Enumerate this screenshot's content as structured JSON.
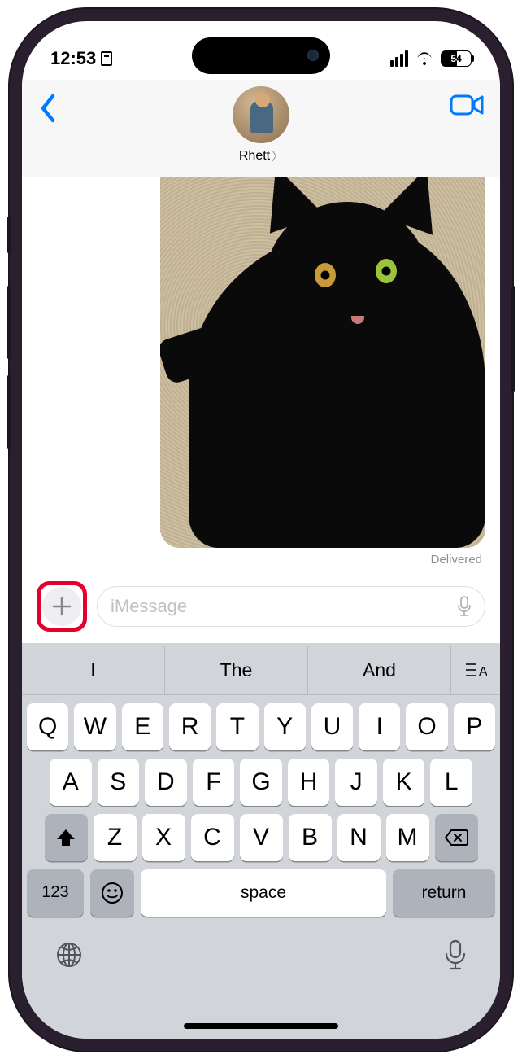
{
  "status": {
    "time": "12:53",
    "battery_pct": "54"
  },
  "header": {
    "contact_name": "Rhett"
  },
  "thread": {
    "last_status": "Delivered"
  },
  "compose": {
    "placeholder": "iMessage"
  },
  "keyboard": {
    "suggestions": [
      "I",
      "The",
      "And"
    ],
    "row1": [
      "Q",
      "W",
      "E",
      "R",
      "T",
      "Y",
      "U",
      "I",
      "O",
      "P"
    ],
    "row2": [
      "A",
      "S",
      "D",
      "F",
      "G",
      "H",
      "J",
      "K",
      "L"
    ],
    "row3": [
      "Z",
      "X",
      "C",
      "V",
      "B",
      "N",
      "M"
    ],
    "fn_label": "123",
    "space_label": "space",
    "return_label": "return"
  },
  "annotation": {
    "highlighted_control": "plus-button"
  }
}
